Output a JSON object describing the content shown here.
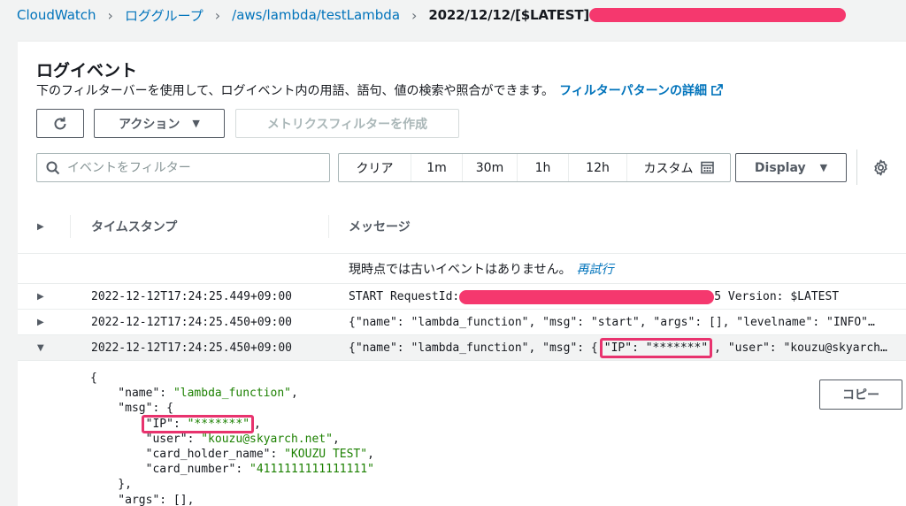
{
  "breadcrumb": {
    "items": [
      "CloudWatch",
      "ロググループ",
      "/aws/lambda/testLambda",
      "2022/12/12/[$LATEST]"
    ]
  },
  "panel": {
    "title": "ログイベント",
    "description": "下のフィルターバーを使用して、ログイベント内の用語、語句、値の検索や照合ができます。",
    "filter_pattern_link": "フィルターパターンの詳細"
  },
  "toolbar": {
    "actions_label": "アクション",
    "metric_filter_label": "メトリクスフィルターを作成",
    "search_placeholder": "イベントをフィルター",
    "ranges": [
      "クリア",
      "1m",
      "30m",
      "1h",
      "12h",
      "カスタム"
    ],
    "display_label": "Display"
  },
  "table": {
    "col_timestamp": "タイムスタンプ",
    "col_message": "メッセージ",
    "notice": "現時点では古いイベントはありません。",
    "retry": "再試行",
    "rows": [
      {
        "timestamp": "2022-12-12T17:24:25.449+09:00",
        "msg_prefix": "START RequestId: ",
        "msg_suffix": "5 Version: $LATEST"
      },
      {
        "timestamp": "2022-12-12T17:24:25.450+09:00",
        "message": "{\"name\": \"lambda_function\", \"msg\": \"start\", \"args\": [], \"levelname\": \"INFO\"…"
      },
      {
        "timestamp": "2022-12-12T17:24:25.450+09:00",
        "msg_prefix": "{\"name\": \"lambda_function\", \"msg\": {",
        "msg_highlight": "\"IP\": \"*******\"",
        "msg_suffix": ", \"user\": \"kouzu@skyarch…"
      }
    ]
  },
  "detail": {
    "copy_label": "コピー",
    "json_lines": [
      {
        "t": "{"
      },
      {
        "k": "    \"name\"",
        "v": "\"lambda_function\"",
        "e": ","
      },
      {
        "k": "    \"msg\"",
        "e": ": {"
      },
      {
        "hk": "        \"IP\"",
        "hv": "\"*******\"",
        "e": ","
      },
      {
        "k": "        \"user\"",
        "v": "\"kouzu@skyarch.net\"",
        "e": ","
      },
      {
        "k": "        \"card_holder_name\"",
        "v": "\"KOUZU TEST\"",
        "e": ","
      },
      {
        "k": "        \"card_number\"",
        "v": "\"4111111111111111\"",
        "e": ""
      },
      {
        "t": "    },"
      },
      {
        "k": "    \"args\"",
        "e": ": [],"
      }
    ]
  },
  "colors": {
    "link": "#0073bb",
    "highlight": "#e8336e",
    "redact": "#f5386e",
    "json_string": "#1d8102"
  }
}
